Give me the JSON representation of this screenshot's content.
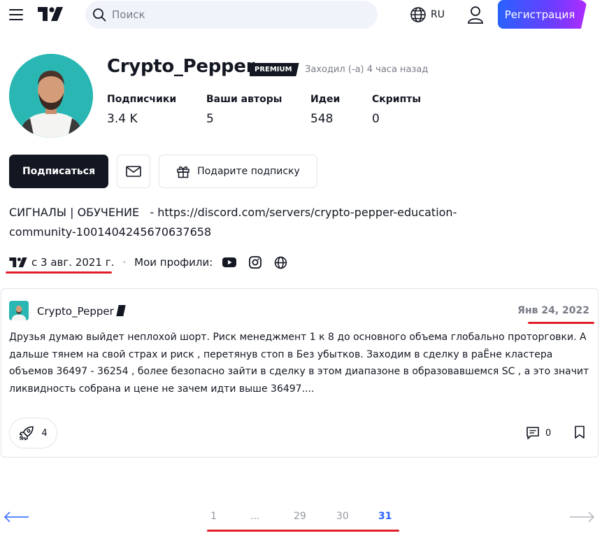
{
  "header": {
    "search_placeholder": "Поиск",
    "language": "RU",
    "register_label": "Регистрация",
    "register_colors": [
      "#2962ff",
      "#b02bff"
    ]
  },
  "profile": {
    "username": "Crypto_Pepper",
    "badge": "PREMIUM",
    "last_seen": "Заходил (-а) 4 часа назад",
    "stats": [
      {
        "label": "Подписчики",
        "value": "3.4 K"
      },
      {
        "label": "Ваши авторы",
        "value": "5"
      },
      {
        "label": "Идеи",
        "value": "548"
      },
      {
        "label": "Скрипты",
        "value": "0"
      }
    ],
    "follow_label": "Подписаться",
    "gift_label": "Подарите подписку",
    "bio_line1": "СИГНАЛЫ | ОБУЧЕНИЕ   - https://discord.com/servers/crypto-pepper-education-",
    "bio_line2": "community-1001404245670637658",
    "since": "с 3 авг. 2021 г.",
    "separator": "·",
    "profiles_label": "Мои профили:",
    "social_icons": [
      "youtube-icon",
      "instagram-icon",
      "globe-icon"
    ]
  },
  "idea": {
    "author": "Crypto_Pepper",
    "date": "Янв 24, 2022",
    "text": "Друзья думаю выйдет неплохой шорт. Риск менеджмент 1 к 8 до основного объема глобально проторговки. А дальше тянем на свой страх и риск , перетянув стоп в Без убытков. Заходим в сделку в раЁне кластера объемов 36497 - 36254 , более безопасно зайти в сделку в этом диапазоне в образовавшемся SC , а это значит ликвидность собрана и цене не зачем идти выше 36497....",
    "boosts": "4",
    "comments": "0"
  },
  "pagination": {
    "pages": [
      "1",
      "...",
      "29",
      "30",
      "31"
    ],
    "active": "31"
  },
  "colors": {
    "text": "#131722",
    "muted": "#787b86",
    "accent": "#2962ff",
    "highlight_underline": "#e11d2a"
  }
}
